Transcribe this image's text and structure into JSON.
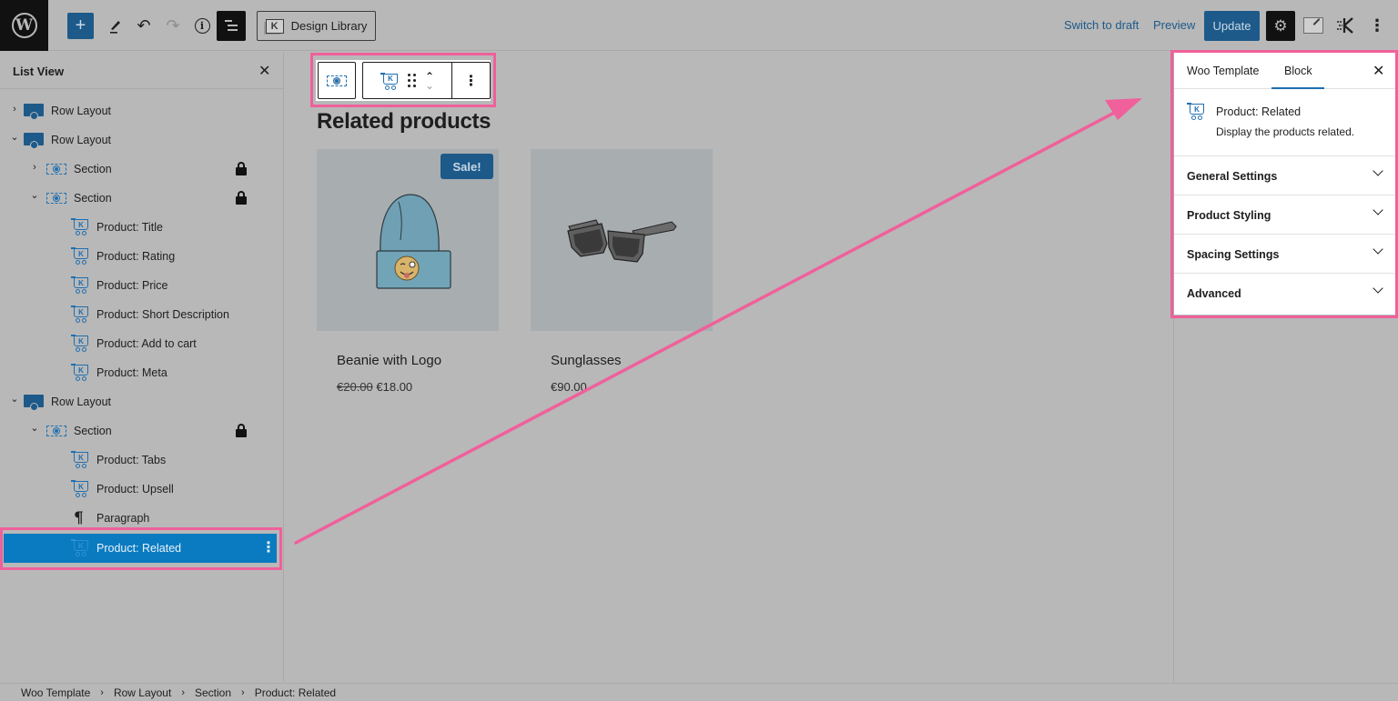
{
  "toolbar": {
    "logo": "W",
    "add_icon": "+",
    "undo_icon": "↶",
    "redo_icon": "↷",
    "info_icon": "i",
    "design_library_label": "Design Library",
    "design_library_icon": "K",
    "switch_to_draft_label": "Switch to draft",
    "preview_label": "Preview",
    "update_label": "Update",
    "settings_icon": "⚙",
    "kadence_icon": "⋠",
    "more_icon": "⋮"
  },
  "list_view": {
    "title": "List View",
    "close_icon": "✕",
    "items": [
      {
        "label": "Row Layout",
        "type": "row",
        "expanded": false,
        "depth": 0,
        "locked": false
      },
      {
        "label": "Row Layout",
        "type": "row",
        "expanded": true,
        "depth": 0,
        "locked": false
      },
      {
        "label": "Section",
        "type": "section",
        "expanded": false,
        "depth": 1,
        "locked": true
      },
      {
        "label": "Section",
        "type": "section",
        "expanded": true,
        "depth": 1,
        "locked": true
      },
      {
        "label": "Product: Title",
        "type": "product",
        "depth": 2,
        "locked": false
      },
      {
        "label": "Product: Rating",
        "type": "product",
        "depth": 2,
        "locked": false
      },
      {
        "label": "Product: Price",
        "type": "product",
        "depth": 2,
        "locked": false
      },
      {
        "label": "Product: Short Description",
        "type": "product",
        "depth": 2,
        "locked": false
      },
      {
        "label": "Product: Add to cart",
        "type": "product",
        "depth": 2,
        "locked": false
      },
      {
        "label": "Product: Meta",
        "type": "product",
        "depth": 2,
        "locked": false
      },
      {
        "label": "Row Layout",
        "type": "row",
        "expanded": true,
        "depth": 0,
        "locked": false
      },
      {
        "label": "Section",
        "type": "section",
        "expanded": true,
        "depth": 1,
        "locked": true
      },
      {
        "label": "Product: Tabs",
        "type": "product",
        "depth": 2,
        "locked": false
      },
      {
        "label": "Product: Upsell",
        "type": "product",
        "depth": 2,
        "locked": false
      },
      {
        "label": "Paragraph",
        "type": "paragraph",
        "depth": 2,
        "locked": false
      },
      {
        "label": "Product: Related",
        "type": "product",
        "depth": 2,
        "locked": false,
        "selected": true
      }
    ],
    "chevron_expanded": "⌄",
    "chevron_collapsed": "›",
    "paragraph_icon": "¶",
    "item_options_icon": "⋮"
  },
  "canvas": {
    "block_toolbar": {
      "parent_icon": "section",
      "block_icon": "cart",
      "move_up_icon": "⌃",
      "move_down_icon": "⌄",
      "options_icon": "⋮"
    },
    "heading": "Related products",
    "products": [
      {
        "name": "Beanie with Logo",
        "regular_price": "€20.00",
        "sale_price": "€18.00",
        "on_sale": true,
        "badge": "Sale!",
        "image": "beanie"
      },
      {
        "name": "Sunglasses",
        "price": "€90.00",
        "on_sale": false,
        "image": "sunglasses"
      }
    ]
  },
  "settings_sidebar": {
    "tabs": [
      {
        "label": "Woo Template",
        "active": false
      },
      {
        "label": "Block",
        "active": true
      }
    ],
    "close_icon": "✕",
    "block_card": {
      "title": "Product: Related",
      "description": "Display the products related."
    },
    "panels": [
      {
        "label": "General Settings",
        "expanded": false
      },
      {
        "label": "Product Styling",
        "expanded": false
      },
      {
        "label": "Spacing Settings",
        "expanded": false
      },
      {
        "label": "Advanced",
        "expanded": false
      }
    ]
  },
  "breadcrumb": {
    "items": [
      "Woo Template",
      "Row Layout",
      "Section",
      "Product: Related"
    ],
    "separator": "›"
  },
  "annotation": {
    "highlight_color": "#f0609a",
    "overlay_color": "#b8b8b8",
    "accent_color": "#1d5a8a"
  }
}
